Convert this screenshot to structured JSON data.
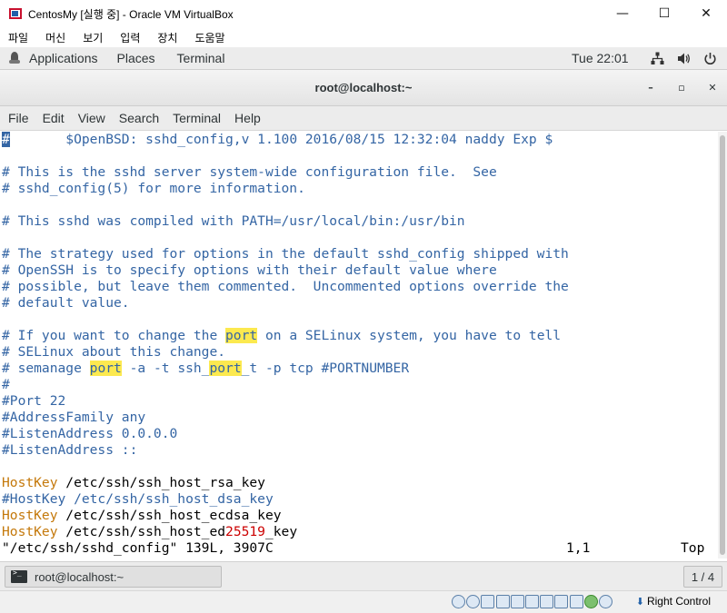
{
  "window": {
    "title": "CentosMy [실행 중] - Oracle VM VirtualBox",
    "minimize": "—",
    "maximize": "☐",
    "close": "✕"
  },
  "vbox_menu": [
    "파일",
    "머신",
    "보기",
    "입력",
    "장치",
    "도움말"
  ],
  "gnome_bar": {
    "applications": "Applications",
    "places": "Places",
    "terminal": "Terminal",
    "clock": "Tue 22:01",
    "icons": [
      "network-icon",
      "volume-icon",
      "power-icon"
    ]
  },
  "terminal": {
    "title": "root@localhost:~",
    "min": "–",
    "max": "▫",
    "close": "✕",
    "menu": [
      "File",
      "Edit",
      "View",
      "Search",
      "Terminal",
      "Help"
    ]
  },
  "content": {
    "l01_cursor": "#",
    "l01_rest": "       $OpenBSD: sshd_config,v 1.100 2016/08/15 12:32:04 naddy Exp $",
    "l03": "# This is the sshd server system-wide configuration file.  See",
    "l04": "# sshd_config(5) for more information.",
    "l06": "# This sshd was compiled with PATH=/usr/local/bin:/usr/bin",
    "l08": "# The strategy used for options in the default sshd_config shipped with",
    "l09": "# OpenSSH is to specify options with their default value where",
    "l10": "# possible, but leave them commented.  Uncommented options override the",
    "l11": "# default value.",
    "l13_a": "# If you want to change the ",
    "l13_hl": "port",
    "l13_b": " on a SELinux system, you have to tell",
    "l14": "# SELinux about this change.",
    "l15_a": "# semanage ",
    "l15_hl1": "port",
    "l15_b": " -a -t ssh_",
    "l15_hl2": "port",
    "l15_c": "_t -p tcp #PORTNUMBER",
    "l16": "#",
    "l17": "#Port 22",
    "l18": "#AddressFamily any",
    "l19": "#ListenAddress 0.0.0.0",
    "l20": "#ListenAddress ::",
    "l22_kw": "HostKey",
    "l22_val": " /etc/ssh/ssh_host_rsa_key",
    "l23": "#HostKey /etc/ssh/ssh_host_dsa_key",
    "l24_kw": "HostKey",
    "l24_val": " /etc/ssh/ssh_host_ecdsa_key",
    "l25_kw": "HostKey",
    "l25_val_a": " /etc/ssh/ssh_host_ed",
    "l25_num": "25519",
    "l25_val_b": "_key",
    "status_file": "\"/etc/ssh/sshd_config\" 139L, 3907C",
    "status_pos": "1,1",
    "status_scroll": "Top"
  },
  "taskbar": {
    "item": "root@localhost:~",
    "workspace": "1 / 4"
  },
  "vbox_status": {
    "host_key": "Right Control",
    "icons": [
      "disk-icon",
      "optical-icon",
      "audio-icon",
      "network-icon",
      "usb-icon",
      "shared-folder-icon",
      "display-icon",
      "recording-icon",
      "cpu-icon",
      "mouse-integration-icon",
      "keyboard-icon"
    ]
  },
  "colors": {
    "comment": "#3465a4",
    "keyword": "#c4780a",
    "highlight": "#fce94f",
    "number": "#cc0000"
  }
}
